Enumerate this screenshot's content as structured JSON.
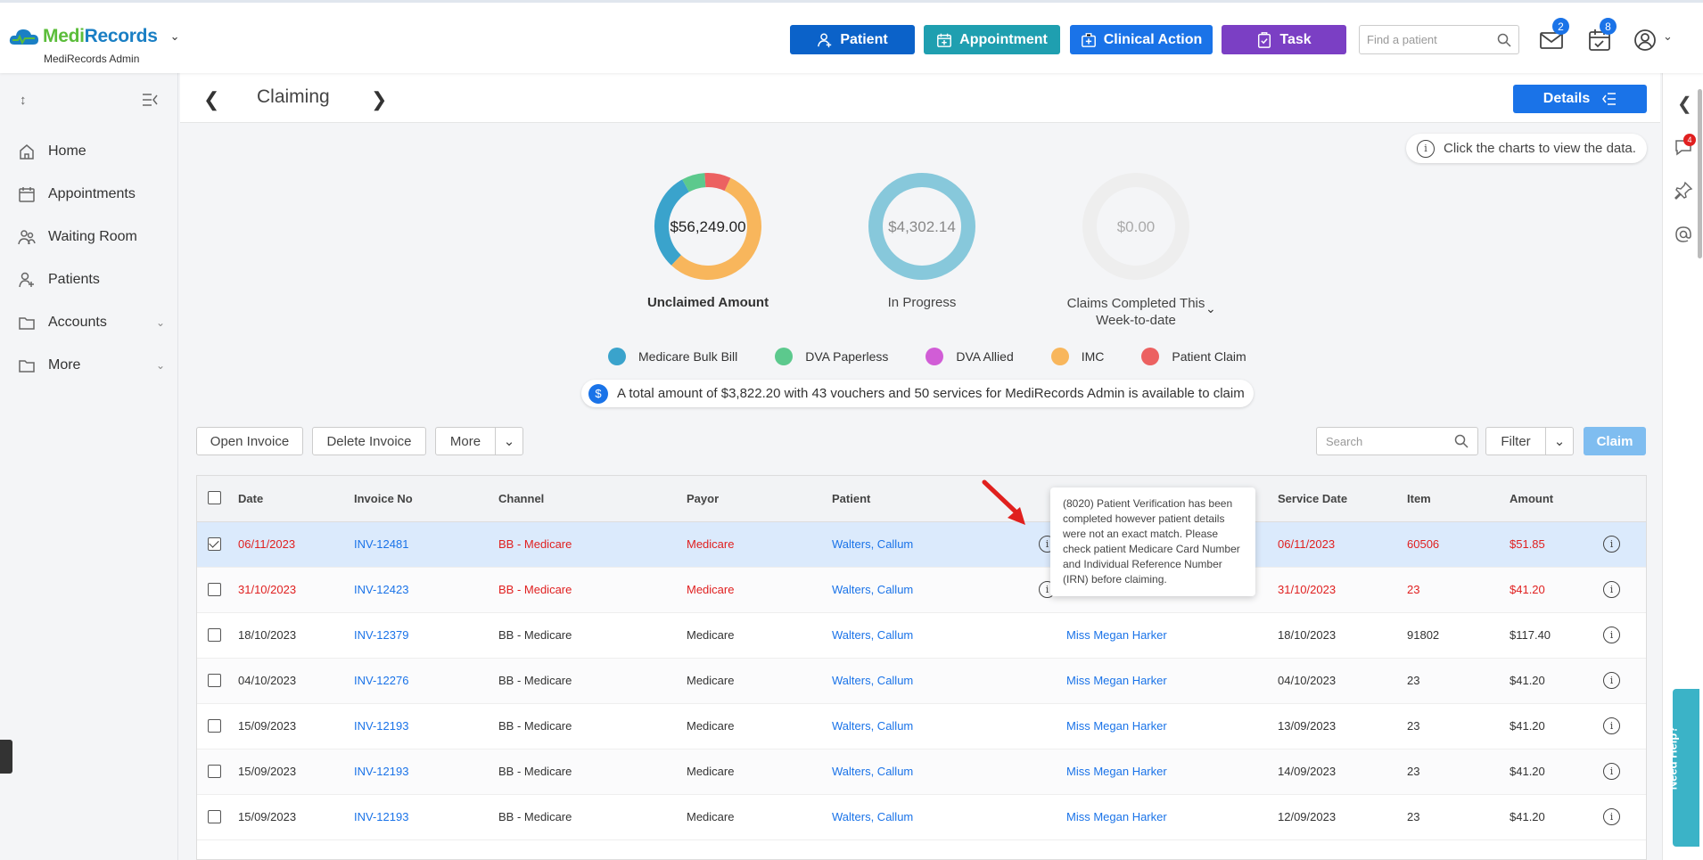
{
  "brand": {
    "name_a": "Medi",
    "name_b": "Records",
    "subtitle": "MediRecords Admin"
  },
  "topbar": {
    "buttons": [
      {
        "label": "Patient",
        "color": "#0b62c9"
      },
      {
        "label": "Appointment",
        "color": "#1f9fb0"
      },
      {
        "label": "Clinical Action",
        "color": "#1a73e8"
      },
      {
        "label": "Task",
        "color": "#7b3fc4"
      }
    ],
    "find_placeholder": "Find a patient",
    "mail_badge": "2",
    "tasks_badge": "8"
  },
  "sidebar": {
    "items": [
      {
        "label": "Home",
        "icon": "home-icon"
      },
      {
        "label": "Appointments",
        "icon": "calendar-icon"
      },
      {
        "label": "Waiting Room",
        "icon": "people-icon"
      },
      {
        "label": "Patients",
        "icon": "patient-icon"
      },
      {
        "label": "Accounts",
        "icon": "folder-icon"
      },
      {
        "label": "More",
        "icon": "folder-icon"
      }
    ]
  },
  "page": {
    "title": "Claiming",
    "details_label": "Details",
    "hint": "Click the charts to view the data."
  },
  "summary": {
    "unclaimed": {
      "value": "$56,249.00",
      "label": "Unclaimed Amount"
    },
    "in_progress": {
      "value": "$4,302.14",
      "label": "In Progress"
    },
    "completed": {
      "value": "$0.00",
      "label_1": "Claims Completed This",
      "label_2": "Week-to-date"
    },
    "available": "A total amount of $3,822.20 with 43 vouchers and 50 services for MediRecords Admin is available to claim"
  },
  "chart_data": {
    "type": "pie",
    "categories": [
      "Medicare Bulk Bill",
      "DVA Paperless",
      "DVA Allied",
      "IMC",
      "Patient Claim"
    ],
    "colors": [
      "#3aa3cc",
      "#5cc98d",
      "#d15dd6",
      "#f8b65c",
      "#ec6161"
    ],
    "values": [
      0.3,
      0.07,
      0.0,
      0.55,
      0.08
    ],
    "title": "Unclaimed Amount"
  },
  "actions": {
    "open_invoice": "Open Invoice",
    "delete_invoice": "Delete Invoice",
    "more": "More",
    "search_placeholder": "Search",
    "filter": "Filter",
    "claim": "Claim"
  },
  "table": {
    "headers": [
      "Date",
      "Invoice No",
      "Channel",
      "Payor",
      "Patient",
      "Service Date",
      "Item",
      "Amount"
    ],
    "rows": [
      {
        "date": "06/11/2023",
        "invoice": "INV-12481",
        "channel": "BB - Medicare",
        "payor": "Medicare",
        "patient": "Walters, Callum",
        "provider": "",
        "service_date": "06/11/2023",
        "item": "60506",
        "amount": "$51.85"
      },
      {
        "date": "31/10/2023",
        "invoice": "INV-12423",
        "channel": "BB - Medicare",
        "payor": "Medicare",
        "patient": "Walters, Callum",
        "provider": "",
        "service_date": "31/10/2023",
        "item": "23",
        "amount": "$41.20"
      },
      {
        "date": "18/10/2023",
        "invoice": "INV-12379",
        "channel": "BB - Medicare",
        "payor": "Medicare",
        "patient": "Walters, Callum",
        "provider": "Miss Megan Harker",
        "service_date": "18/10/2023",
        "item": "91802",
        "amount": "$117.40"
      },
      {
        "date": "04/10/2023",
        "invoice": "INV-12276",
        "channel": "BB - Medicare",
        "payor": "Medicare",
        "patient": "Walters, Callum",
        "provider": "Miss Megan Harker",
        "service_date": "04/10/2023",
        "item": "23",
        "amount": "$41.20"
      },
      {
        "date": "15/09/2023",
        "invoice": "INV-12193",
        "channel": "BB - Medicare",
        "payor": "Medicare",
        "patient": "Walters, Callum",
        "provider": "Miss Megan Harker",
        "service_date": "13/09/2023",
        "item": "23",
        "amount": "$41.20"
      },
      {
        "date": "15/09/2023",
        "invoice": "INV-12193",
        "channel": "BB - Medicare",
        "payor": "Medicare",
        "patient": "Walters, Callum",
        "provider": "Miss Megan Harker",
        "service_date": "14/09/2023",
        "item": "23",
        "amount": "$41.20"
      },
      {
        "date": "15/09/2023",
        "invoice": "INV-12193",
        "channel": "BB - Medicare",
        "payor": "Medicare",
        "patient": "Walters, Callum",
        "provider": "Miss Megan Harker",
        "service_date": "12/09/2023",
        "item": "23",
        "amount": "$41.20"
      }
    ]
  },
  "tooltip": "(8020) Patient Verification has been completed however patient details were not an exact match. Please check patient Medicare Card Number and Individual Reference Number (IRN) before claiming.",
  "right_panel": {
    "chat_badge": "4",
    "help_label": "Need Help?"
  }
}
